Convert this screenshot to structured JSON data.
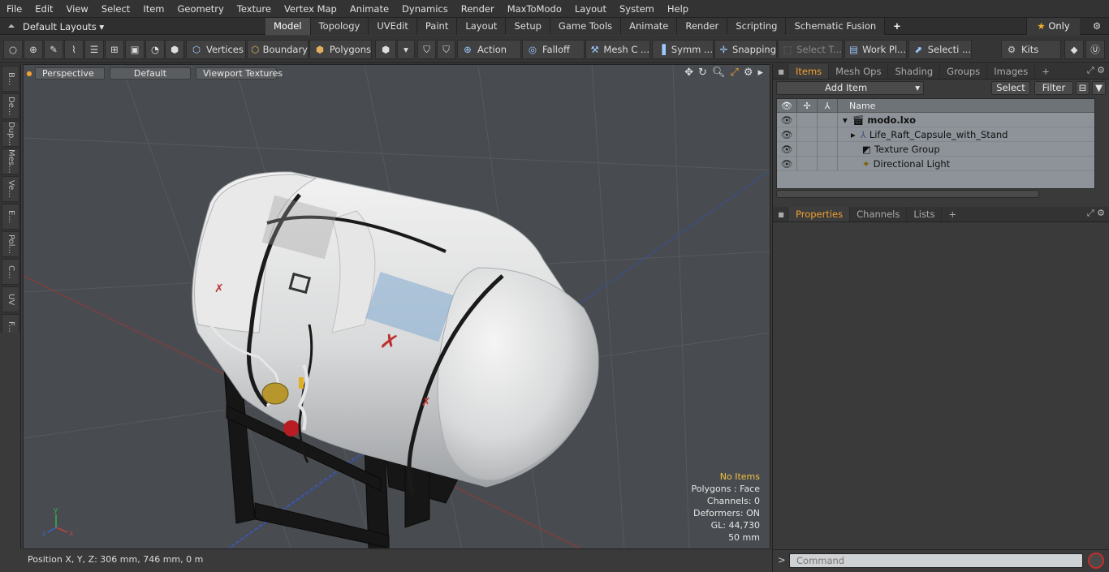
{
  "menu": [
    "File",
    "Edit",
    "View",
    "Select",
    "Item",
    "Geometry",
    "Texture",
    "Vertex Map",
    "Animate",
    "Dynamics",
    "Render",
    "MaxToModo",
    "Layout",
    "System",
    "Help"
  ],
  "layouts": {
    "label": "Default Layouts"
  },
  "tabs": [
    "Model",
    "Topology",
    "UVEdit",
    "Paint",
    "Layout",
    "Setup",
    "Game Tools",
    "Animate",
    "Render",
    "Scripting",
    "Schematic Fusion"
  ],
  "active_tab": "Model",
  "only_label": "Only",
  "toolbar": {
    "vertices": "Vertices",
    "boundary": "Boundary",
    "polygons": "Polygons",
    "action": "Action",
    "falloff": "Falloff",
    "mesh": "Mesh C ...",
    "symm": "Symm ...",
    "snapping": "Snapping",
    "select_t": "Select T...",
    "work_pl": "Work Pl...",
    "selecti": "Selecti ...",
    "kits": "Kits"
  },
  "left_tabs": [
    "B...",
    "De...",
    "Dup...",
    "Mes...",
    "Ve...",
    "E...",
    "Pol...",
    "C...",
    "UV",
    "F..."
  ],
  "viewport": {
    "perspective": "Perspective",
    "default": "Default",
    "textures": "Viewport Textures",
    "stats": {
      "no_items": "No Items",
      "polygons": "Polygons : Face",
      "channels": "Channels: 0",
      "deformers": "Deformers: ON",
      "gl": "GL: 44,730",
      "scale": "50 mm"
    }
  },
  "status": {
    "position": "Position X, Y, Z:   306 mm, 746 mm, 0 m"
  },
  "items_panel": {
    "tabs": [
      "Items",
      "Mesh Ops",
      "Shading",
      "Groups",
      "Images"
    ],
    "add_item": "Add Item",
    "select": "Select",
    "filter": "Filter",
    "col_name": "Name",
    "rows": [
      {
        "name": "modo.lxo"
      },
      {
        "name": "Life_Raft_Capsule_with_Stand"
      },
      {
        "name": "Texture Group"
      },
      {
        "name": "Directional Light"
      }
    ]
  },
  "props_panel": {
    "tabs": [
      "Properties",
      "Channels",
      "Lists"
    ]
  },
  "command": {
    "placeholder": "Command"
  }
}
